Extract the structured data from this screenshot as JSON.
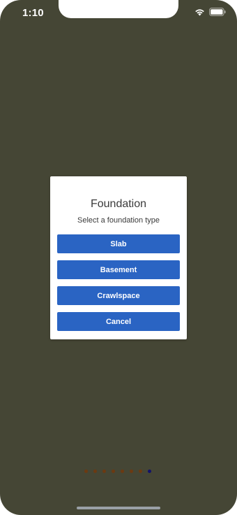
{
  "status_bar": {
    "time": "1:10",
    "icons": [
      "wifi-icon",
      "battery-icon"
    ]
  },
  "dialog": {
    "title": "Foundation",
    "subtitle": "Select a foundation type",
    "options": [
      {
        "label": "Slab"
      },
      {
        "label": "Basement"
      },
      {
        "label": "Crawlspace"
      }
    ],
    "cancel_label": "Cancel"
  },
  "page_indicator": {
    "count": 8,
    "active_index": 7
  },
  "colors": {
    "background": "#454635",
    "button": "#2a64c3",
    "dot_inactive": "#6b3a12",
    "dot_active": "#12126b"
  }
}
